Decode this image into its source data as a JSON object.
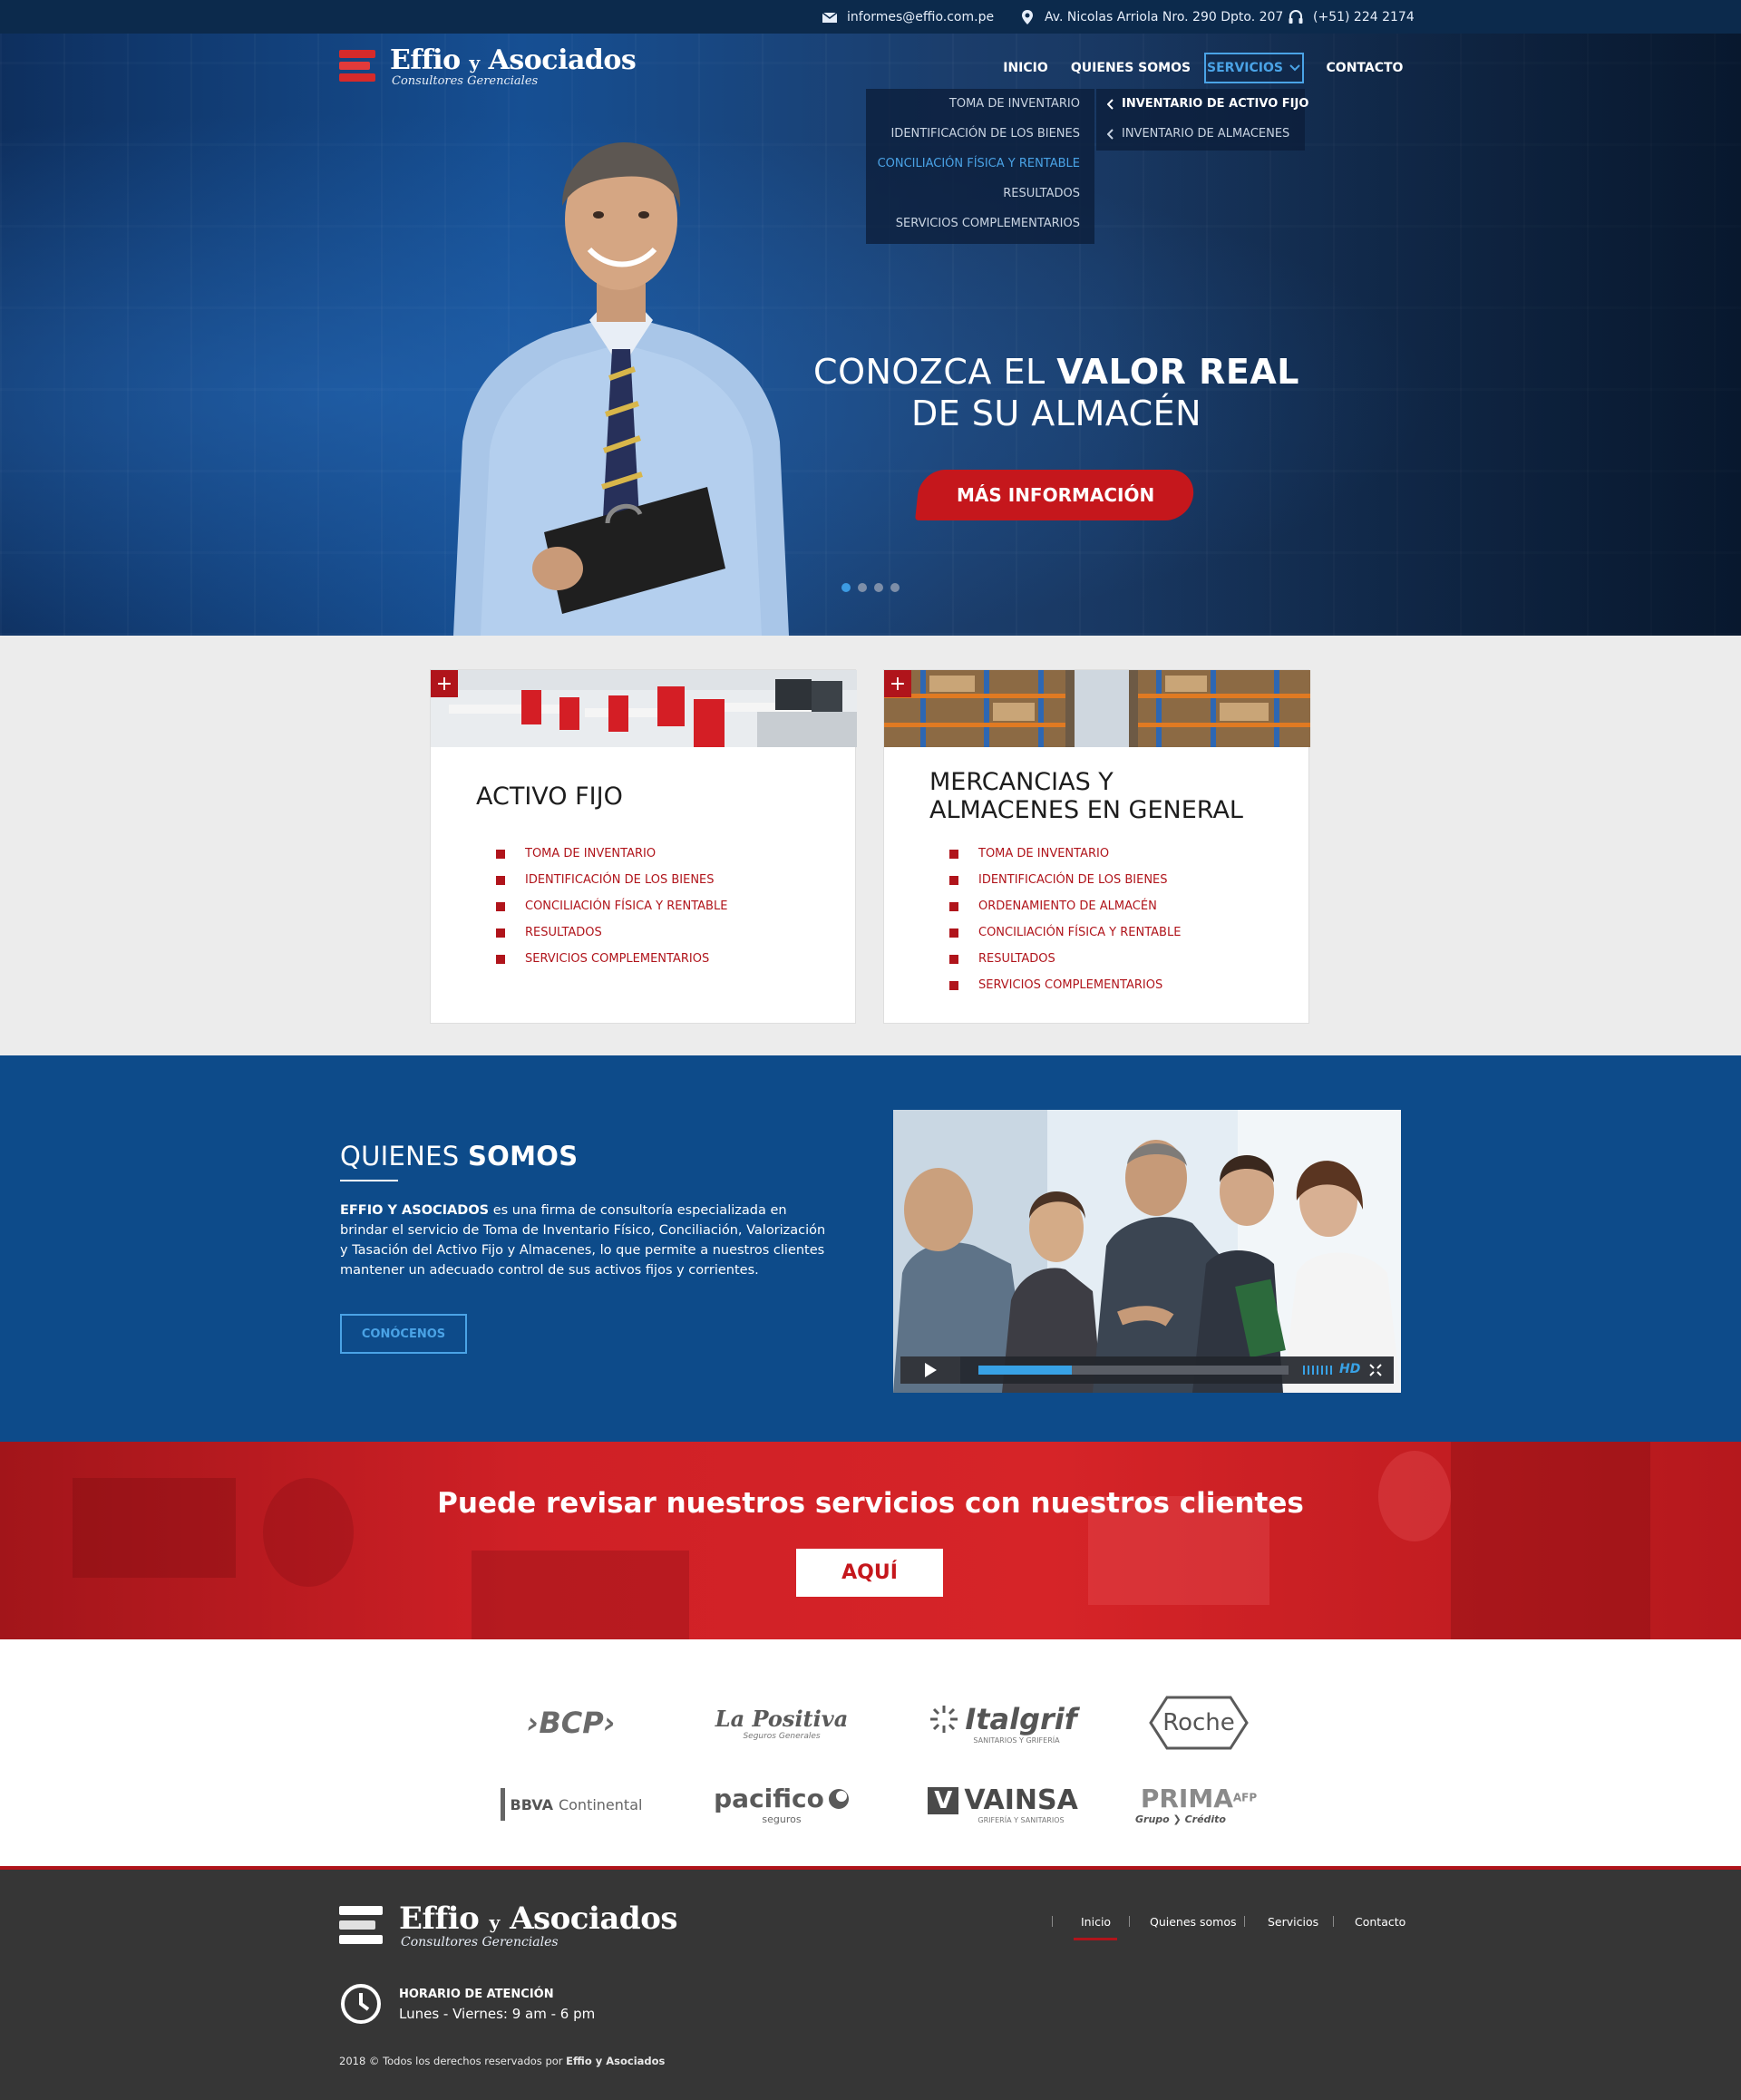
{
  "topbar": {
    "email": "informes@effio.com.pe",
    "address": "Av. Nicolas Arriola Nro. 290 Dpto. 207",
    "phone": "(+51) 224 2174"
  },
  "brand": {
    "name_part1": "Effio",
    "name_part2": "y",
    "name_part3": "Asociados",
    "tagline": "Consultores Gerenciales"
  },
  "nav": {
    "items": [
      "INICIO",
      "QUIENES SOMOS",
      "SERVICIOS",
      "CONTACTO"
    ],
    "active_index": 2
  },
  "services_dropdown": {
    "items": [
      "TOMA DE INVENTARIO",
      "IDENTIFICACIÓN DE LOS BIENES",
      "CONCILIACIÓN FÍSICA Y RENTABLE",
      "RESULTADOS",
      "SERVICIOS COMPLEMENTARIOS"
    ],
    "highlighted_index": 2,
    "submenu": [
      "INVENTARIO DE ACTIVO FIJO",
      "INVENTARIO DE ALMACENES"
    ]
  },
  "hero": {
    "title_line1_light": "CONOZCA EL",
    "title_line1_bold": "VALOR REAL",
    "title_line2": "DE SU ALMACÉN",
    "cta": "MÁS INFORMACIÓN",
    "slide_count": 4,
    "active_slide": 1
  },
  "cards": [
    {
      "title": "ACTIVO FIJO",
      "items": [
        "TOMA DE INVENTARIO",
        "IDENTIFICACIÓN DE LOS BIENES",
        "CONCILIACIÓN FÍSICA Y RENTABLE",
        "RESULTADOS",
        "SERVICIOS COMPLEMENTARIOS"
      ]
    },
    {
      "title_line1": "MERCANCIAS Y",
      "title_line2": "ALMACENES EN GENERAL",
      "items": [
        "TOMA DE INVENTARIO",
        "IDENTIFICACIÓN DE LOS BIENES",
        "ORDENAMIENTO DE ALMACÉN",
        "CONCILIACIÓN FÍSICA Y RENTABLE",
        "RESULTADOS",
        "SERVICIOS COMPLEMENTARIOS"
      ]
    }
  ],
  "about": {
    "title_light": "QUIENES",
    "title_bold": "SOMOS",
    "text_bold": "EFFIO Y ASOCIADOS",
    "text_rest": " es una firma de consultoría especializada en brindar el servicio de Toma de Inventario Físico, Conciliación, Valorización y Tasación del Activo Fijo y Almacenes, lo que permite a nuestros clientes mantener un adecuado control de sus activos fijos y corrientes.",
    "button": "CONÓCENOS",
    "video_progress": 0.3,
    "video_quality": "HD"
  },
  "banner": {
    "title": "Puede revisar nuestros servicios con nuestros clientes",
    "button": "AQUÍ"
  },
  "clients": {
    "bcp": "›BCP›",
    "lapositiva": "La Positiva",
    "lapositiva_sub": "Seguros Generales",
    "italgrif": "Italgrif",
    "italgrif_sub": "SANITARIOS Y GRIFERÍA",
    "roche": "Roche",
    "bbva": "BBVA",
    "bbva_rest": "Continental",
    "pacifico": "pacifico",
    "pacifico_sub": "seguros",
    "vainsa_mark": "V",
    "vainsa": "VAINSA",
    "vainsa_sub": "GRIFERÍA Y SANITARIOS",
    "prima": "PRIMA",
    "prima_sup": "AFP",
    "prima_sub": "Grupo ❯ Crédito"
  },
  "footer": {
    "nav": [
      "Inicio",
      "Quienes somos",
      "Servicios",
      "Contacto"
    ],
    "active_index": 0,
    "hours_title": "HORARIO DE ATENCIÓN",
    "hours_value": "Lunes - Viernes: 9 am - 6 pm",
    "copyright_text": "2018 © Todos los derechos reservados por ",
    "copyright_bold": "Effio y Asociados"
  },
  "colors": {
    "topbar": "#0c2a4c",
    "brand_red": "#c5171c",
    "accent_blue": "#4aa3e6",
    "about_blue": "#0d4b8a",
    "footer": "#363636"
  }
}
